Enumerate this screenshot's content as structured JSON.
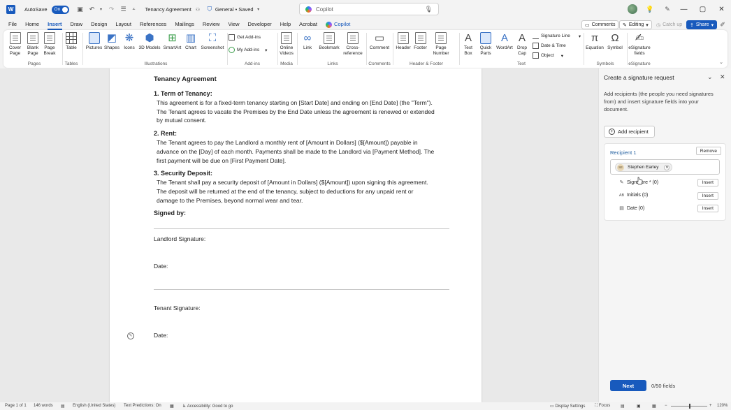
{
  "titlebar": {
    "autosave_label": "AutoSave",
    "autosave_state": "On",
    "doc_title": "Tenancy Agreement",
    "sensitivity": "General • Saved",
    "search_placeholder": "Copilot",
    "window_controls": [
      "minimize",
      "maximize",
      "close"
    ]
  },
  "tabs": [
    "File",
    "Home",
    "Insert",
    "Draw",
    "Design",
    "Layout",
    "References",
    "Mailings",
    "Review",
    "View",
    "Developer",
    "Help",
    "Acrobat",
    "Copilot"
  ],
  "active_tab": "Insert",
  "tab_right": {
    "comments": "Comments",
    "editing": "Editing",
    "catch_up": "Catch up",
    "share": "Share"
  },
  "ribbon": {
    "pages": {
      "label": "Pages",
      "items": [
        "Cover Page",
        "Blank Page",
        "Page Break"
      ]
    },
    "tables": {
      "label": "Tables",
      "items": [
        "Table"
      ]
    },
    "illustrations": {
      "label": "Illustrations",
      "items": [
        "Pictures",
        "Shapes",
        "Icons",
        "3D Models",
        "SmartArt",
        "Chart",
        "Screenshot"
      ]
    },
    "addins": {
      "label": "Add-ins",
      "items": [
        "Get Add-ins",
        "My Add-ins"
      ]
    },
    "media": {
      "label": "Media",
      "items": [
        "Online Videos"
      ]
    },
    "links": {
      "label": "Links",
      "items": [
        "Link",
        "Bookmark",
        "Cross-reference"
      ]
    },
    "comments": {
      "label": "Comments",
      "items": [
        "Comment"
      ]
    },
    "header_footer": {
      "label": "Header & Footer",
      "items": [
        "Header",
        "Footer",
        "Page Number"
      ]
    },
    "text": {
      "label": "Text",
      "items": [
        "Text Box",
        "Quick Parts",
        "WordArt",
        "Drop Cap",
        "Signature Line",
        "Date & Time",
        "Object"
      ]
    },
    "symbols": {
      "label": "Symbols",
      "items": [
        "Equation",
        "Symbol"
      ]
    },
    "esignature": {
      "label": "eSignature",
      "items": [
        "eSignature fields"
      ]
    }
  },
  "document": {
    "title": "Tenancy Agreement",
    "sections": [
      {
        "heading": "1. Term of Tenancy:",
        "body": "This agreement is for a fixed-term tenancy starting on [Start Date] and ending on [End Date] (the \"Term\"). The Tenant agrees to vacate the Premises by the End Date unless the agreement is renewed or extended by mutual consent."
      },
      {
        "heading": "2. Rent:",
        "body": "The Tenant agrees to pay the Landlord a monthly rent of [Amount in Dollars] ($[Amount]) payable in advance on the [Day] of each month.   Payments shall be made to the Landlord via [Payment Method]. The first payment will be due on [First Payment Date]."
      },
      {
        "heading": "3. Security Deposit:",
        "body": "The Tenant shall pay a security deposit of [Amount in Dollars] ($[Amount]) upon signing this agreement. The deposit will be returned at the end of the tenancy, subject to deductions for any unpaid rent or damage to the Premises, beyond normal wear and tear."
      }
    ],
    "signed_by": "Signed by:",
    "landlord_signature": "Landlord Signature:",
    "date1": "Date:",
    "tenant_signature": "Tenant Signature:",
    "date2": "Date:"
  },
  "panel": {
    "title": "Create a signature request",
    "description": "Add recipients (the people you need signatures from) and insert signature fields into your document.",
    "add_recipient": "Add recipient",
    "recipient_title": "Recipient 1",
    "remove": "Remove",
    "recipient_initials": "SE",
    "recipient_name": "Stephen Earley",
    "fields": [
      {
        "icon": "signature-pen-icon",
        "label": "Signature * (0)",
        "button": "Insert"
      },
      {
        "icon": "initials-icon",
        "label": "Initials (0)",
        "button": "Insert"
      },
      {
        "icon": "calendar-icon",
        "label": "Date (0)",
        "button": "Insert"
      }
    ],
    "next": "Next",
    "fields_count": "0/50 fields"
  },
  "statusbar": {
    "page": "Page 1 of 1",
    "words": "146 words",
    "language": "English (United States)",
    "predictions": "Text Predictions: On",
    "accessibility": "Accessibility: Good to go",
    "display_settings": "Display Settings",
    "focus": "Focus",
    "zoom": "120%"
  },
  "colors": {
    "accent": "#185abd",
    "link_blue": "#1f5d9e"
  }
}
